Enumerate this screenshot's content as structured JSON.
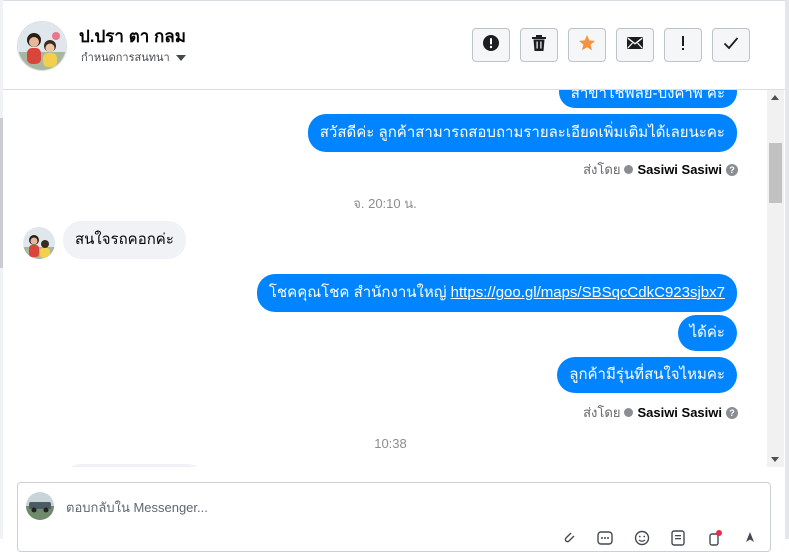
{
  "header": {
    "contact_name": "ป.ปรา ตา กลม",
    "subtitle": "กำหนดการสนทนา",
    "buttons": [
      {
        "icon": "alert-circle-icon",
        "glyph": "!"
      },
      {
        "icon": "trash-icon"
      },
      {
        "icon": "star-icon",
        "color": "#f5923e"
      },
      {
        "icon": "mail-icon"
      },
      {
        "icon": "exclamation-icon",
        "glyph": "!"
      },
      {
        "icon": "check-icon"
      }
    ]
  },
  "messages": {
    "partial_top": "สาขาไชพิลย์-ปิงคาพ ค่ะ",
    "m1": "สวัสดีค่ะ ลูกค้าสามารถสอบถามรายละเอียดเพิ่มเติมได้เลยนะคะ",
    "sent_by_label": "ส่งโดย",
    "sender": "Sasiwi Sasiwi",
    "timestamp1": "จ. 20:10 น.",
    "incoming1": "สนใจรถคอกค่ะ",
    "m2_text": "โชคคุณโชค สำนักงานใหญ่",
    "m2_link": "https://goo.gl/maps/SBSqcCdkC923sjbx7",
    "m3": "ได้ค่ะ",
    "m4": "ลูกค้ามีรุ่นที่สนใจไหมคะ",
    "timestamp2": "10:38"
  },
  "composer": {
    "placeholder": "ตอบกลับใน Messenger..."
  },
  "colors": {
    "outgoing_bubble": "#0084ff",
    "incoming_bubble": "#f0f2f5",
    "star": "#f5923e",
    "notification_dot": "#f02849"
  }
}
